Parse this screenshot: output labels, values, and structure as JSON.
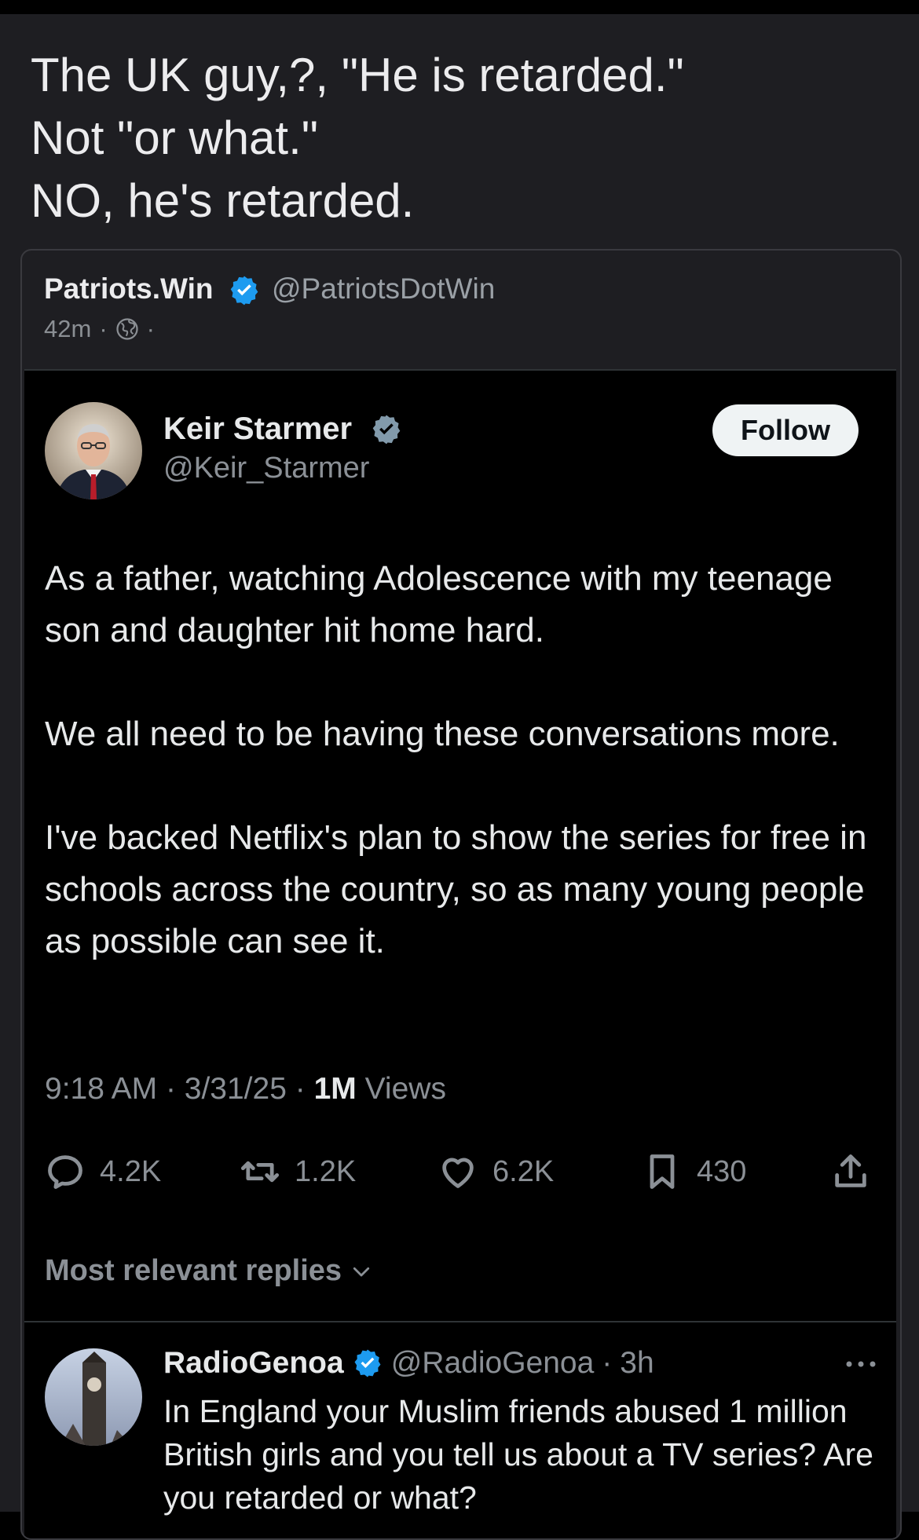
{
  "post": {
    "lines": [
      "The UK guy,?, \"He is retarded.\"",
      "Not \"or what.\"",
      "NO, he's retarded."
    ]
  },
  "quote_header": {
    "name": "Patriots.Win",
    "handle": "@PatriotsDotWin",
    "time": "42m",
    "sep1": "·",
    "sep2": "·"
  },
  "tweet": {
    "name": "Keir Starmer",
    "handle": "@Keir_Starmer",
    "follow_label": "Follow",
    "paragraphs": [
      "As a father, watching Adolescence with my teenage son and daughter hit home hard.",
      "We all need to be having these conversations more.",
      "I've backed Netflix's plan to show the series for free in schools across the country, so as many young people as possible can see it."
    ],
    "time": "9:18 AM",
    "date": "3/31/25",
    "views_count": "1M",
    "views_label": "Views",
    "replies": "4.2K",
    "reposts": "1.2K",
    "likes": "6.2K",
    "bookmarks": "430",
    "sort_label": "Most relevant replies"
  },
  "reply": {
    "name": "RadioGenoa",
    "handle": "@RadioGenoa",
    "time": "3h",
    "sep": "·",
    "text": "In England your Muslim friends abused 1 million British girls and you tell us about a TV series? Are you retarded or what?"
  },
  "colors": {
    "verified": "#1d9bf0",
    "tweet_bg": "#000000",
    "page_bg": "#1e1e22"
  }
}
